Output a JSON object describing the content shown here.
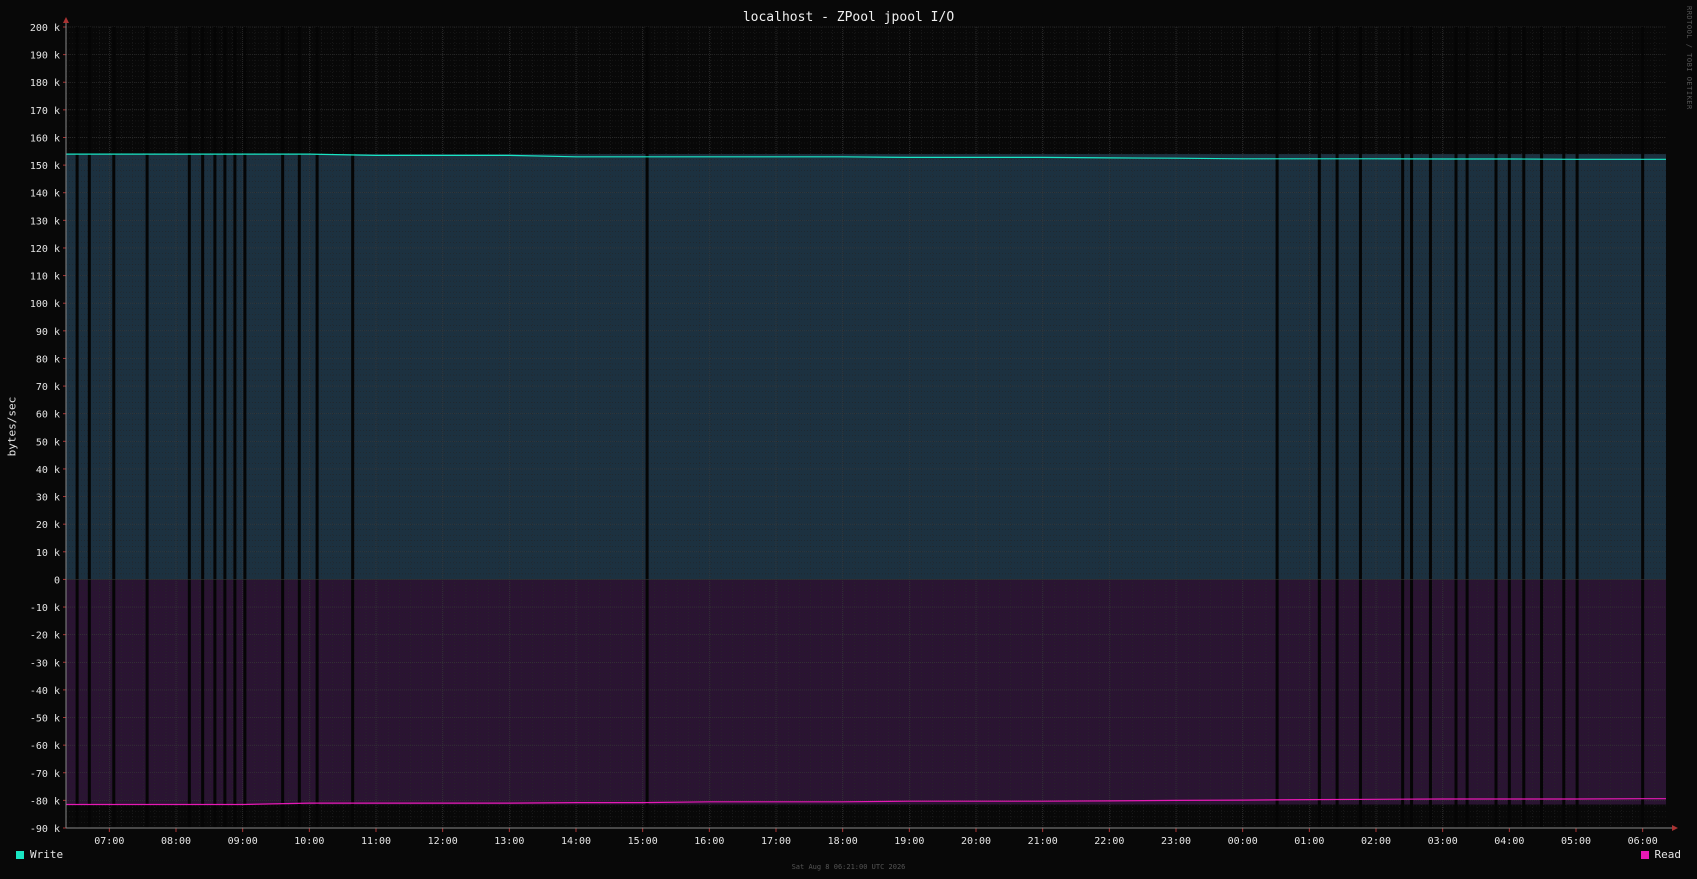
{
  "title": "localhost - ZPool jpool I/O",
  "ylabel": "bytes/sec",
  "watermark": "RRDTOOL / TOBI OETIKER",
  "footer": "Sat Aug  8 06:21:00 UTC 2026",
  "colors": {
    "write": "#19e6c3",
    "read": "#e619b4",
    "write_fill": "#1c3140",
    "read_fill": "#2a1432",
    "background": "#080808"
  },
  "legend": {
    "write": {
      "label": "Write",
      "color": "#19e6c3"
    },
    "read": {
      "label": "Read",
      "color": "#e619b4"
    }
  },
  "chart_data": {
    "type": "area",
    "title": "localhost - ZPool jpool I/O",
    "ylabel": "bytes/sec",
    "ylim": [
      -90000,
      200000
    ],
    "y_ticks": [
      200000,
      190000,
      180000,
      170000,
      160000,
      150000,
      140000,
      130000,
      120000,
      110000,
      100000,
      90000,
      80000,
      70000,
      60000,
      50000,
      40000,
      30000,
      20000,
      10000,
      0,
      -10000,
      -20000,
      -30000,
      -40000,
      -50000,
      -60000,
      -70000,
      -80000,
      -90000
    ],
    "y_tick_labels": [
      "200 k",
      "190 k",
      "180 k",
      "170 k",
      "160 k",
      "150 k",
      "140 k",
      "130 k",
      "120 k",
      "110 k",
      "100 k",
      "90 k",
      "80 k",
      "70 k",
      "60 k",
      "50 k",
      "40 k",
      "30 k",
      "20 k",
      "10 k",
      "0",
      "-10 k",
      "-20 k",
      "-30 k",
      "-40 k",
      "-50 k",
      "-60 k",
      "-70 k",
      "-80 k",
      "-90 k"
    ],
    "xlim": [
      "06:21",
      "06:21"
    ],
    "x_tick_labels": [
      "07:00",
      "08:00",
      "09:00",
      "10:00",
      "11:00",
      "12:00",
      "13:00",
      "14:00",
      "15:00",
      "16:00",
      "17:00",
      "18:00",
      "19:00",
      "20:00",
      "21:00",
      "22:00",
      "23:00",
      "00:00",
      "01:00",
      "02:00",
      "03:00",
      "04:00",
      "05:00",
      "06:00"
    ],
    "grid": true,
    "legend_position": "bottom",
    "series": [
      {
        "name": "Write",
        "color": "#19e6c3",
        "times": [
          "06:21",
          "07:00",
          "08:00",
          "09:00",
          "10:00",
          "11:00",
          "12:00",
          "13:00",
          "14:00",
          "15:00",
          "16:00",
          "17:00",
          "18:00",
          "19:00",
          "20:00",
          "21:00",
          "22:00",
          "23:00",
          "00:00",
          "01:00",
          "02:00",
          "03:00",
          "04:00",
          "05:00",
          "06:00",
          "06:21"
        ],
        "values": [
          154000,
          154000,
          154000,
          154000,
          154000,
          153500,
          153500,
          153500,
          153000,
          153000,
          153000,
          153000,
          153000,
          152800,
          152800,
          152800,
          152600,
          152500,
          152300,
          152300,
          152300,
          152200,
          152200,
          152100,
          152100,
          152100
        ]
      },
      {
        "name": "Read",
        "color": "#e619b4",
        "times": [
          "06:21",
          "07:00",
          "08:00",
          "09:00",
          "10:00",
          "11:00",
          "12:00",
          "13:00",
          "14:00",
          "15:00",
          "16:00",
          "17:00",
          "18:00",
          "19:00",
          "20:00",
          "21:00",
          "22:00",
          "23:00",
          "00:00",
          "01:00",
          "02:00",
          "03:00",
          "04:00",
          "05:00",
          "06:00",
          "06:21"
        ],
        "values": [
          -81500,
          -81500,
          -81500,
          -81500,
          -81000,
          -81000,
          -81000,
          -81000,
          -80800,
          -80800,
          -80500,
          -80500,
          -80500,
          -80300,
          -80300,
          -80300,
          -80200,
          -80000,
          -79900,
          -79700,
          -79600,
          -79500,
          -79500,
          -79500,
          -79400,
          -79400
        ]
      }
    ],
    "gaps": [
      "06:31",
      "06:42",
      "07:04",
      "07:34",
      "08:12",
      "08:24",
      "08:35",
      "08:44",
      "08:53",
      "09:02",
      "09:36",
      "09:51",
      "10:07",
      "10:39",
      "15:04",
      "00:31",
      "01:09",
      "01:25",
      "01:46",
      "02:24",
      "02:32",
      "02:49",
      "03:12",
      "03:22",
      "03:48",
      "04:00",
      "04:13",
      "04:29",
      "04:49",
      "05:01",
      "06:00"
    ]
  }
}
